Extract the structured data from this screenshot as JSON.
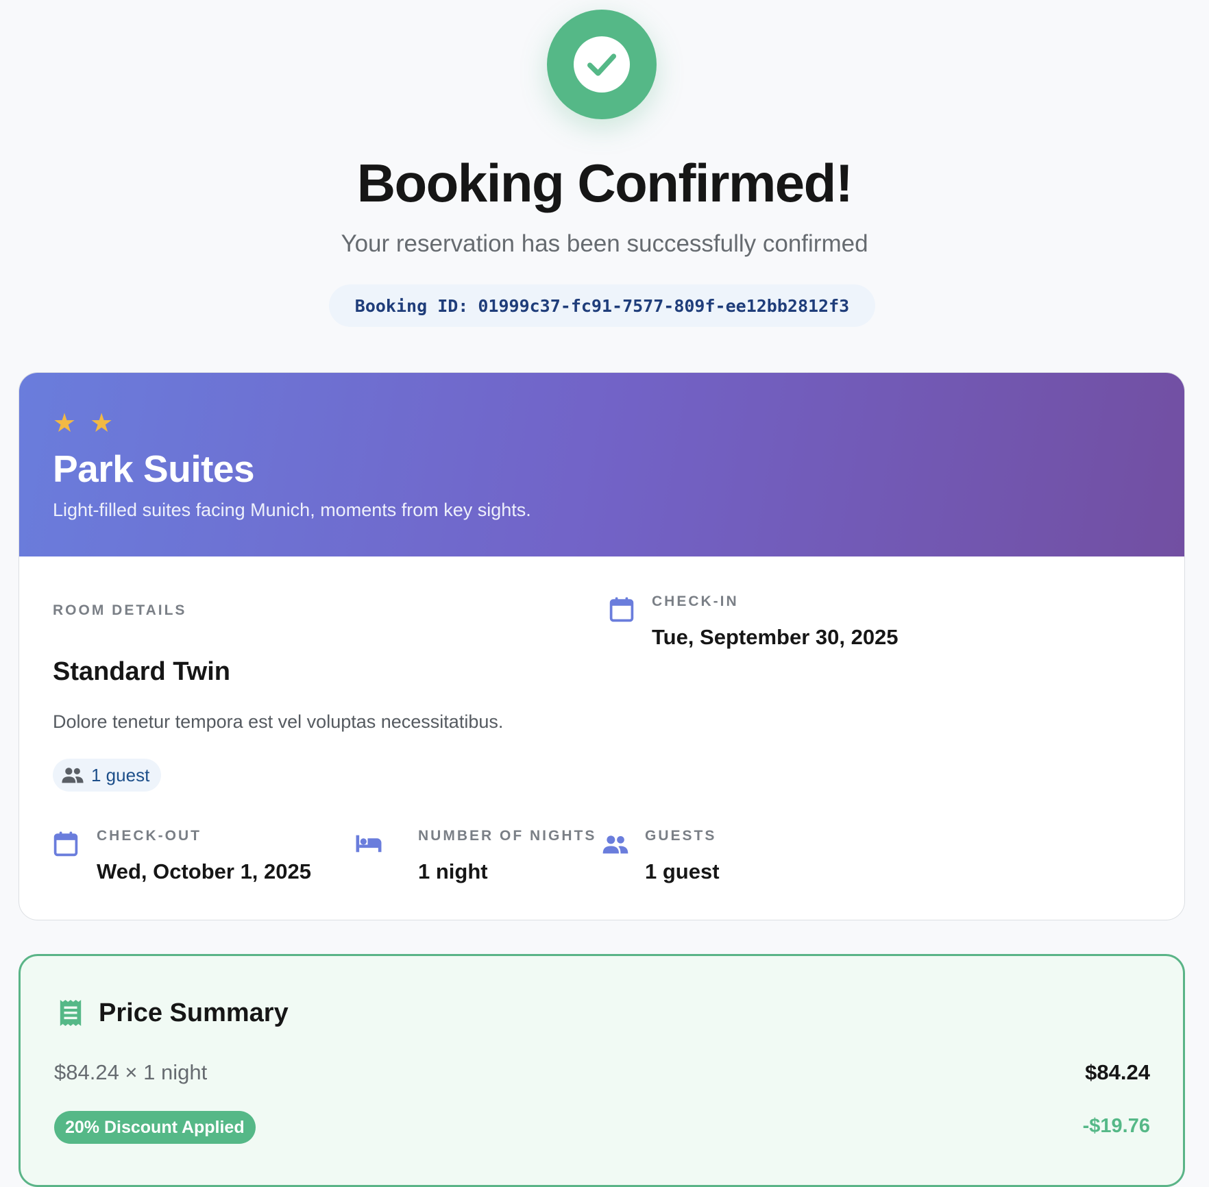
{
  "confirmation": {
    "title": "Booking Confirmed!",
    "subtitle": "Your reservation has been successfully confirmed",
    "booking_id_label": "Booking ID:",
    "booking_id": "01999c37-fc91-7577-809f-ee12bb2812f3"
  },
  "hotel": {
    "star_count": 2,
    "name": "Park Suites",
    "description": "Light-filled suites facing Munich, moments from key sights."
  },
  "room": {
    "section_label": "ROOM DETAILS",
    "name": "Standard Twin",
    "description": "Dolore tenetur tempora est vel voluptas necessitatibus.",
    "guest_pill": "1 guest"
  },
  "stay": {
    "check_in_label": "CHECK-IN",
    "check_in": "Tue, September 30, 2025",
    "check_out_label": "CHECK-OUT",
    "check_out": "Wed, October 1, 2025",
    "nights_label": "NUMBER OF NIGHTS",
    "nights": "1 night",
    "guests_label": "GUESTS",
    "guests": "1 guest"
  },
  "price": {
    "title": "Price Summary",
    "line_desc": "$84.24 × 1 night",
    "line_amount": "$84.24",
    "discount_label": "20% Discount Applied",
    "discount_amount": "-$19.76"
  },
  "colors": {
    "success": "#55b887",
    "accent": "#6a7ddc",
    "header_gradient_end": "#724fa2",
    "star": "#f2b944"
  },
  "icons": {
    "confirmation": "check-icon",
    "calendar": "calendar-icon",
    "bed": "bed-icon",
    "guests": "people-icon",
    "receipt": "receipt-icon",
    "star": "star-icon"
  }
}
